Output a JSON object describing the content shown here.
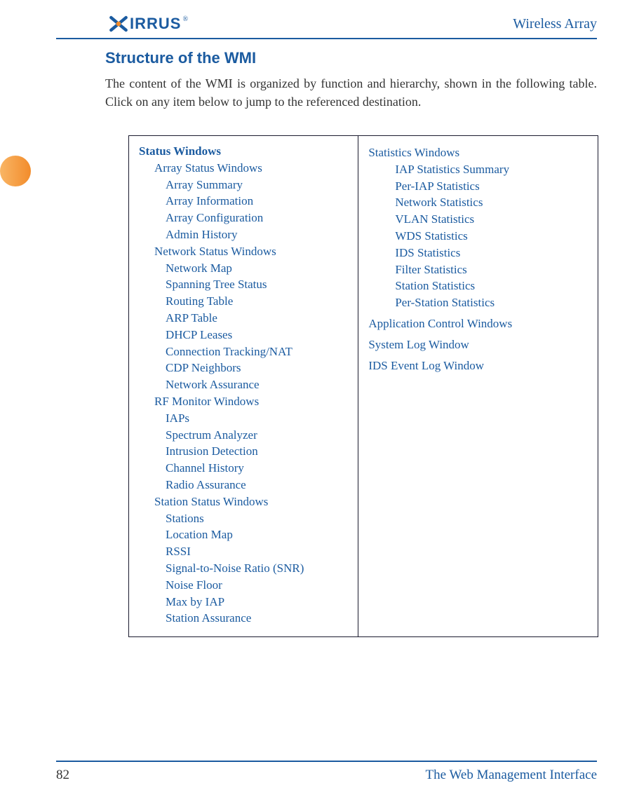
{
  "header": {
    "logo_text": "IRRUS",
    "logo_brand_alt": "Xirrus X-mark",
    "right_text": "Wireless Array"
  },
  "section": {
    "title": "Structure of the WMI",
    "intro": "The content of the WMI is organized by function and hierarchy, shown in the following table. Click on any item below to jump to the referenced destination."
  },
  "table": {
    "left": [
      {
        "label": "Status Windows",
        "level": 0,
        "bold": true
      },
      {
        "label": "Array Status Windows",
        "level": 1
      },
      {
        "label": "Array Summary",
        "level": 2
      },
      {
        "label": "Array Information",
        "level": 2
      },
      {
        "label": "Array Configuration",
        "level": 2
      },
      {
        "label": "Admin History",
        "level": 2
      },
      {
        "label": "Network Status Windows",
        "level": 1
      },
      {
        "label": "Network Map",
        "level": 2
      },
      {
        "label": "Spanning Tree Status",
        "level": 2
      },
      {
        "label": "Routing Table",
        "level": 2
      },
      {
        "label": "ARP Table",
        "level": 2
      },
      {
        "label": "DHCP Leases",
        "level": 2
      },
      {
        "label": "Connection Tracking/NAT",
        "level": 2
      },
      {
        "label": "CDP Neighbors",
        "level": 2
      },
      {
        "label": "Network Assurance",
        "level": 2
      },
      {
        "label": "RF Monitor Windows",
        "level": 1
      },
      {
        "label": "IAPs",
        "level": 2
      },
      {
        "label": "Spectrum Analyzer",
        "level": 2
      },
      {
        "label": "Intrusion Detection",
        "level": 2
      },
      {
        "label": "Channel History",
        "level": 2
      },
      {
        "label": "Radio Assurance",
        "level": 2
      },
      {
        "label": "Station Status Windows",
        "level": 1
      },
      {
        "label": "Stations",
        "level": 2
      },
      {
        "label": "Location Map",
        "level": 2
      },
      {
        "label": "RSSI",
        "level": 2
      },
      {
        "label": "Signal-to-Noise Ratio (SNR)",
        "level": 2
      },
      {
        "label": "Noise Floor",
        "level": 2
      },
      {
        "label": "Max by IAP",
        "level": 2
      },
      {
        "label": "Station Assurance",
        "level": 2
      }
    ],
    "right": [
      {
        "label": "Statistics Windows",
        "level": 0
      },
      {
        "label": "IAP Statistics Summary",
        "level": 2
      },
      {
        "label": "Per-IAP Statistics",
        "level": 2
      },
      {
        "label": "Network Statistics",
        "level": 2
      },
      {
        "label": "VLAN Statistics",
        "level": 2
      },
      {
        "label": "WDS Statistics",
        "level": 2
      },
      {
        "label": "IDS Statistics",
        "level": 2
      },
      {
        "label": "Filter Statistics",
        "level": 2
      },
      {
        "label": "Station Statistics",
        "level": 2
      },
      {
        "label": "Per-Station Statistics",
        "level": 2
      },
      {
        "label": "Application Control Windows",
        "level": 0,
        "gap": true
      },
      {
        "label": "System Log Window",
        "level": 0,
        "gap": true
      },
      {
        "label": "IDS Event Log Window",
        "level": 0,
        "gap": true
      }
    ]
  },
  "footer": {
    "page": "82",
    "title": "The Web Management Interface"
  }
}
